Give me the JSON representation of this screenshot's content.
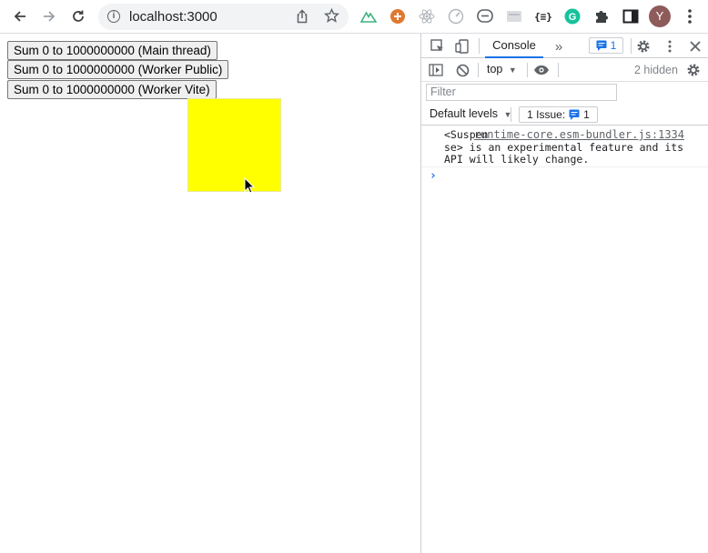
{
  "browser": {
    "url": "localhost:3000",
    "avatar_initial": "Y"
  },
  "page": {
    "buttons": [
      "Sum 0 to 1000000000 (Main thread)",
      "Sum 0 to 1000000000 (Worker Public)",
      "Sum 0 to 1000000000 (Worker Vite)"
    ],
    "box_color": "#ffff00"
  },
  "devtools": {
    "tab_console": "Console",
    "issues_badge": "1",
    "context": "top",
    "hidden_count": "2 hidden",
    "filter_placeholder": "Filter",
    "levels": "Default levels",
    "issue_pill_label": "1 Issue:",
    "issue_pill_count": "1",
    "message": {
      "source": "runtime-core.esm-bundler.js:1334",
      "lines": [
        "<Suspen",
        "se> is an experimental feature and its",
        "API will likely change."
      ]
    },
    "prompt": "›"
  },
  "colors": {
    "accent": "#1a73e8",
    "box": "#ffff00"
  }
}
